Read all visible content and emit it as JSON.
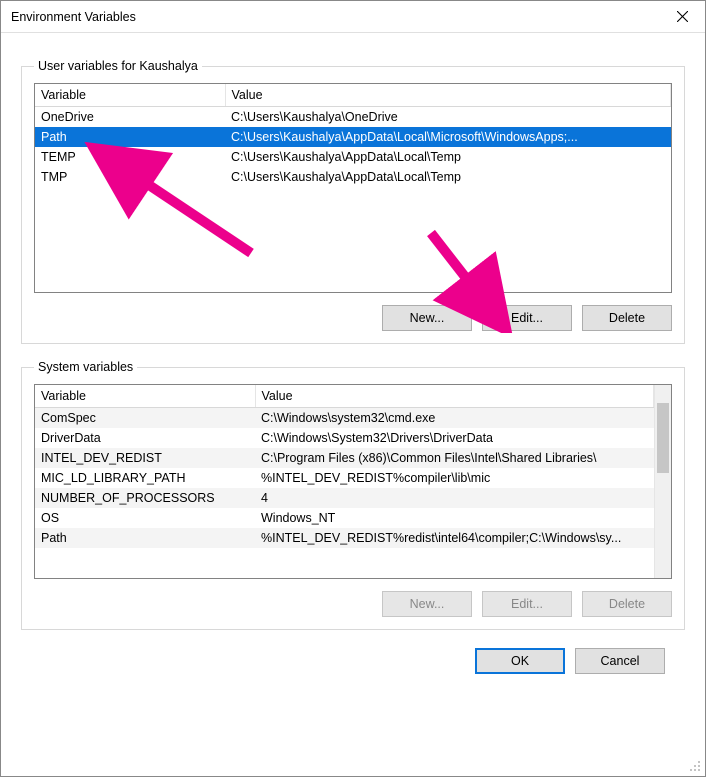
{
  "window": {
    "title": "Environment Variables"
  },
  "user_section": {
    "legend": "User variables for Kaushalya",
    "col_variable": "Variable",
    "col_value": "Value",
    "rows": [
      {
        "variable": "OneDrive",
        "value": "C:\\Users\\Kaushalya\\OneDrive",
        "selected": false
      },
      {
        "variable": "Path",
        "value": "C:\\Users\\Kaushalya\\AppData\\Local\\Microsoft\\WindowsApps;...",
        "selected": true
      },
      {
        "variable": "TEMP",
        "value": "C:\\Users\\Kaushalya\\AppData\\Local\\Temp",
        "selected": false
      },
      {
        "variable": "TMP",
        "value": "C:\\Users\\Kaushalya\\AppData\\Local\\Temp",
        "selected": false
      }
    ],
    "buttons": {
      "new": "New...",
      "edit": "Edit...",
      "delete": "Delete"
    }
  },
  "system_section": {
    "legend": "System variables",
    "col_variable": "Variable",
    "col_value": "Value",
    "rows": [
      {
        "variable": "ComSpec",
        "value": "C:\\Windows\\system32\\cmd.exe"
      },
      {
        "variable": "DriverData",
        "value": "C:\\Windows\\System32\\Drivers\\DriverData"
      },
      {
        "variable": "INTEL_DEV_REDIST",
        "value": "C:\\Program Files (x86)\\Common Files\\Intel\\Shared Libraries\\"
      },
      {
        "variable": "MIC_LD_LIBRARY_PATH",
        "value": "%INTEL_DEV_REDIST%compiler\\lib\\mic"
      },
      {
        "variable": "NUMBER_OF_PROCESSORS",
        "value": "4"
      },
      {
        "variable": "OS",
        "value": "Windows_NT"
      },
      {
        "variable": "Path",
        "value": "%INTEL_DEV_REDIST%redist\\intel64\\compiler;C:\\Windows\\sy..."
      }
    ],
    "buttons": {
      "new": "New...",
      "edit": "Edit...",
      "delete": "Delete"
    }
  },
  "footer": {
    "ok": "OK",
    "cancel": "Cancel"
  },
  "annotation_color": "#ec008c"
}
